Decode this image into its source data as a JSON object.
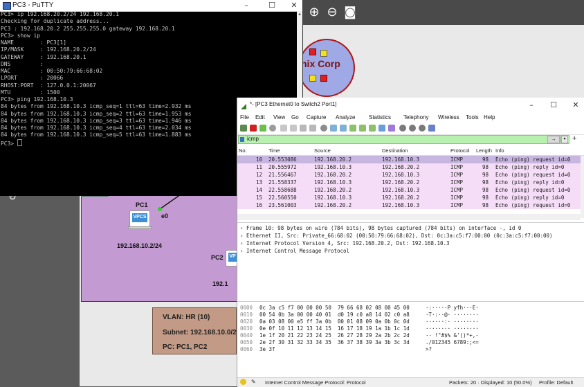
{
  "putty": {
    "title": "PC3 - PuTTY",
    "lines": [
      "PC3> ip 192.168.20.2/24 192.168.20.1",
      "Checking for duplicate address...",
      "PC3 : 192.168.20.2 255.255.255.0 gateway 192.168.20.1",
      "",
      "PC3> show ip",
      "",
      "NAME        : PC3[1]",
      "IP/MASK     : 192.168.20.2/24",
      "GATEWAY     : 192.168.20.1",
      "DNS         :",
      "MAC         : 00:50:79:66:68:02",
      "LPORT       : 20066",
      "RHOST:PORT  : 127.0.0.1:20067",
      "MTU         : 1500",
      "",
      "PC3> ping 192.168.10.3",
      "",
      "84 bytes from 192.168.10.3 icmp_seq=1 ttl=63 time=2.932 ms",
      "84 bytes from 192.168.10.3 icmp_seq=2 ttl=63 time=1.953 ms",
      "84 bytes from 192.168.10.3 icmp_seq=3 ttl=63 time=1.946 ms",
      "84 bytes from 192.168.10.3 icmp_seq=4 ttl=63 time=2.034 ms",
      "84 bytes from 192.168.10.3 icmp_seq=5 ttl=63 time=1.883 ms",
      "",
      "PC3> "
    ]
  },
  "gns3": {
    "cloud_label": "nix Corp",
    "pc1_label": "PC1",
    "pc1_iface": "e0",
    "pc1_ip": "192.168.10.2/24",
    "pc2_label": "PC2",
    "pc2_ip": "192.1",
    "vpcs_text": "VPCS",
    "vpcs_text_partial": "VP",
    "info": {
      "vlan": "VLAN: HR (10)",
      "subnet": "Subnet: 192.168.10.0/2",
      "pcs": "PC: PC1, PC2"
    }
  },
  "wireshark": {
    "title": "*- [PC3 Ethernet0 to Switch2 Port1]",
    "menu": [
      "File",
      "Edit",
      "View",
      "Go",
      "Capture",
      "Analyze",
      "Statistics",
      "Telephony",
      "Wireless",
      "Tools",
      "Help"
    ],
    "filter": "icmp",
    "columns": [
      "No.",
      "Time",
      "Source",
      "Destination",
      "Protocol",
      "Length",
      "Info"
    ],
    "packets": [
      {
        "no": "10",
        "time": "20.553086",
        "src": "192.168.20.2",
        "dst": "192.168.10.3",
        "proto": "ICMP",
        "len": "98",
        "info": "Echo (ping) request  id=0"
      },
      {
        "no": "11",
        "time": "20.555972",
        "src": "192.168.10.3",
        "dst": "192.168.20.2",
        "proto": "ICMP",
        "len": "98",
        "info": "Echo (ping) reply    id=0"
      },
      {
        "no": "12",
        "time": "21.556467",
        "src": "192.168.20.2",
        "dst": "192.168.10.3",
        "proto": "ICMP",
        "len": "98",
        "info": "Echo (ping) request  id=0"
      },
      {
        "no": "13",
        "time": "21.558337",
        "src": "192.168.10.3",
        "dst": "192.168.20.2",
        "proto": "ICMP",
        "len": "98",
        "info": "Echo (ping) reply    id=0"
      },
      {
        "no": "14",
        "time": "22.558688",
        "src": "192.168.20.2",
        "dst": "192.168.10.3",
        "proto": "ICMP",
        "len": "98",
        "info": "Echo (ping) request  id=0"
      },
      {
        "no": "15",
        "time": "22.560550",
        "src": "192.168.10.3",
        "dst": "192.168.20.2",
        "proto": "ICMP",
        "len": "98",
        "info": "Echo (ping) reply    id=0"
      },
      {
        "no": "16",
        "time": "23.561003",
        "src": "192.168.20.2",
        "dst": "192.168.10.3",
        "proto": "ICMP",
        "len": "98",
        "info": "Echo (ping) request  id=0"
      }
    ],
    "details": [
      "Frame 10: 98 bytes on wire (784 bits), 98 bytes captured (784 bits) on interface -, id 0",
      "Ethernet II, Src: Private_66:68:02 (00:50:79:66:68:02), Dst: 0c:3a:c5:f7:00:00 (0c:3a:c5:f7:00:00)",
      "Internet Protocol Version 4, Src: 192.168.20.2, Dst: 192.168.10.3",
      "Internet Control Message Protocol"
    ],
    "bytes": [
      {
        "off": "0000",
        "hex": "0c 3a c5 f7 00 00 00 50  79 66 68 02 08 00 45 00",
        "ascii": "·:·····P yfh···E·"
      },
      {
        "off": "0010",
        "hex": "00 54 0b 3a 00 00 40 01  d0 19 c0 a8 14 02 c0 a8",
        "ascii": "·T·:··@· ········"
      },
      {
        "off": "0020",
        "hex": "0a 03 08 00 e5 ff 3a 0b  00 01 08 09 0a 0b 0c 0d",
        "ascii": "······:· ········"
      },
      {
        "off": "0030",
        "hex": "0e 0f 10 11 12 13 14 15  16 17 18 19 1a 1b 1c 1d",
        "ascii": "········ ········"
      },
      {
        "off": "0040",
        "hex": "1e 1f 20 21 22 23 24 25  26 27 28 29 2a 2b 2c 2d",
        "ascii": "·· !\"#$% &'()*+,-"
      },
      {
        "off": "0050",
        "hex": "2e 2f 30 31 32 33 34 35  36 37 38 39 3a 3b 3c 3d",
        "ascii": "./012345 6789:;<="
      },
      {
        "off": "0060",
        "hex": "3e 3f",
        "ascii": ">?"
      }
    ],
    "status": {
      "left": "Internet Control Message Protocol: Protocol",
      "packets": "Packets: 20 · Displayed: 10 (50.0%)",
      "profile": "Profile: Default"
    }
  }
}
